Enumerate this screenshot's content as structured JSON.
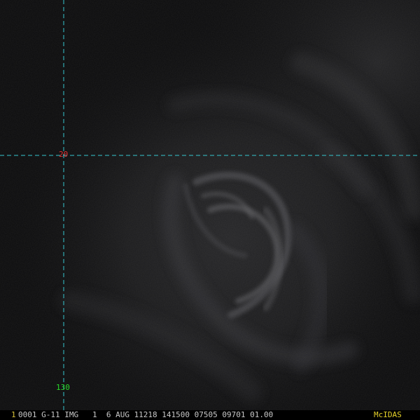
{
  "grid": {
    "latitude_label": "20",
    "longitude_label": "130",
    "line_color": "#35c6cf"
  },
  "status": {
    "frame_number": "1",
    "text": "0001 G-11 IMG   1  6 AUG 11218 141500 07505 09701 01.00",
    "brand": "McIDAS"
  },
  "colors": {
    "background": "#0a0a0b",
    "latitude_label": "#e03030",
    "longitude_label": "#29d829",
    "frame_number": "#d8c23a",
    "status_text": "#c8c8c8",
    "brand": "#e6d22a"
  }
}
